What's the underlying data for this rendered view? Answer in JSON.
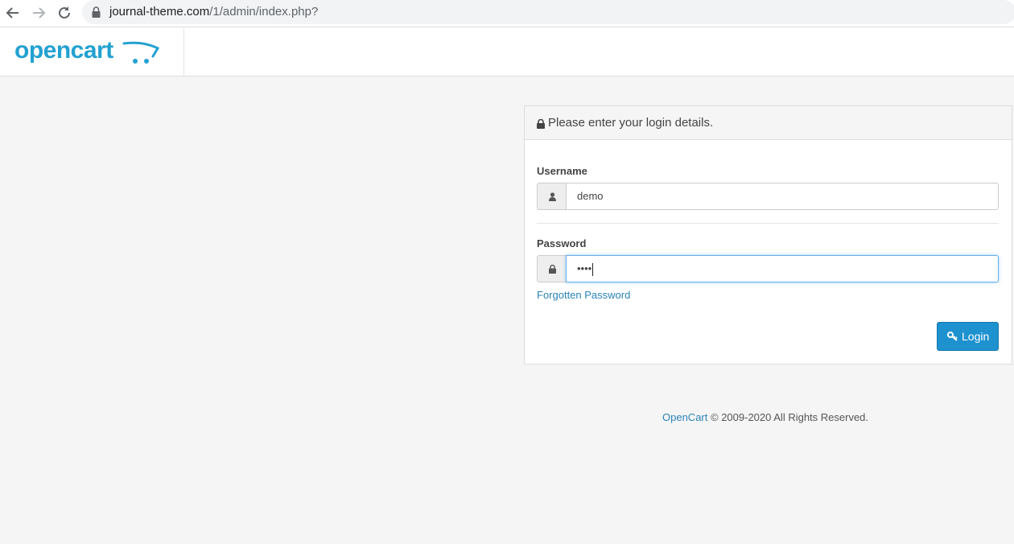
{
  "browser": {
    "url_host": "journal-theme.com",
    "url_path": "/1/admin/index.php?"
  },
  "header": {
    "logo_text": "opencart"
  },
  "login": {
    "title": "Please enter your login details.",
    "username_label": "Username",
    "username_value": "demo",
    "password_label": "Password",
    "password_value": "••••",
    "forgot_link": "Forgotten Password",
    "login_button": "Login"
  },
  "footer": {
    "brand_link": "OpenCart",
    "copyright": "© 2009-2020 All Rights Reserved."
  },
  "colors": {
    "brand": "#23a1d1",
    "button": "#1e91cf",
    "link": "#2a83b8"
  }
}
